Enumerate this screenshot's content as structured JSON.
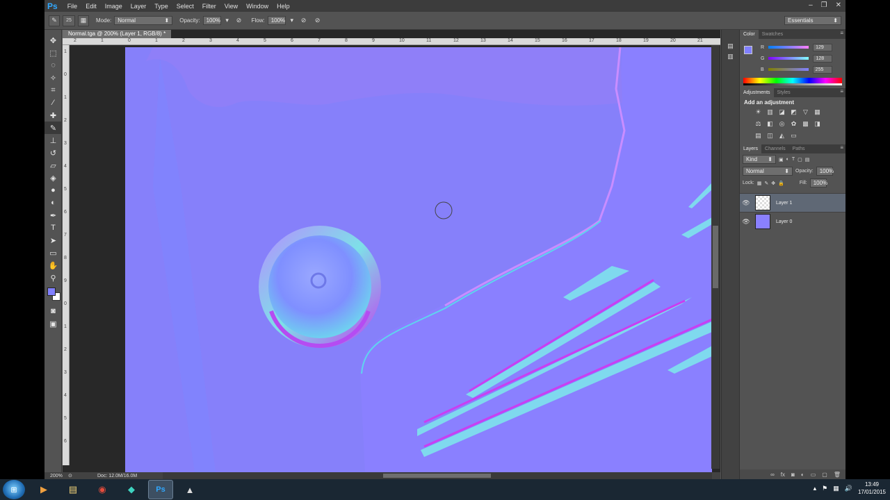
{
  "app": {
    "logo": "Ps",
    "menu": [
      "File",
      "Edit",
      "Image",
      "Layer",
      "Type",
      "Select",
      "Filter",
      "View",
      "Window",
      "Help"
    ],
    "window_buttons": [
      "–",
      "❐",
      "✕"
    ]
  },
  "options": {
    "brush_size": "25",
    "mode_label": "Mode:",
    "mode": "Normal",
    "opacity_label": "Opacity:",
    "opacity": "100%",
    "flow_label": "Flow:",
    "flow": "100%",
    "workspace": "Essentials"
  },
  "document": {
    "tab": "Normal.tga @ 200% (Layer 1, RGB/8) *",
    "ruler_h": [
      "2",
      "1",
      "0",
      "1",
      "2",
      "3",
      "4",
      "5",
      "6",
      "7",
      "8",
      "9",
      "10",
      "11",
      "12",
      "13",
      "14",
      "15",
      "16",
      "17",
      "18",
      "19",
      "20",
      "21"
    ],
    "ruler_v": [
      "1",
      "0",
      "1",
      "2",
      "3",
      "4",
      "5",
      "6",
      "7",
      "8",
      "9",
      "0",
      "1",
      "2",
      "3",
      "4",
      "5",
      "6"
    ]
  },
  "status": {
    "zoom": "200%",
    "doc": "Doc: 12.0M/16.0M"
  },
  "color_panel": {
    "tabs": [
      "Color",
      "Swatches"
    ],
    "r_label": "R",
    "r": "129",
    "g_label": "G",
    "g": "128",
    "b_label": "B",
    "b": "255",
    "foreground": "#8180ff"
  },
  "adjustments": {
    "tabs": [
      "Adjustments",
      "Styles"
    ],
    "title": "Add an adjustment"
  },
  "layers": {
    "tabs": [
      "Layers",
      "Channels",
      "Paths"
    ],
    "kind": "Kind",
    "blend": "Normal",
    "opacity_label": "Opacity:",
    "opacity": "100%",
    "lock_label": "Lock:",
    "fill_label": "Fill:",
    "fill": "100%",
    "items": [
      {
        "name": "Layer 1"
      },
      {
        "name": "Layer 0"
      }
    ]
  },
  "taskbar": {
    "time": "13:49",
    "date": "17/01/2015"
  }
}
